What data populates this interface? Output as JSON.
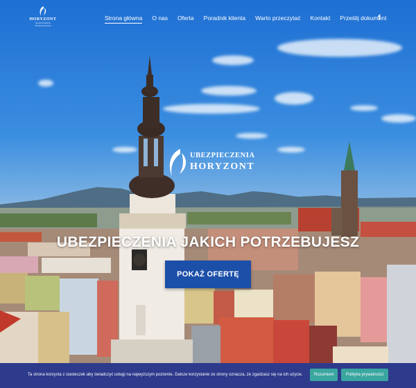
{
  "nav": {
    "logo_text": "HORYZONT",
    "logo_sub": "Grupa Doradcze Ubezpieczeniowe",
    "items": [
      {
        "label": "Strona główna",
        "active": true
      },
      {
        "label": "O nas"
      },
      {
        "label": "Oferta"
      },
      {
        "label": "Poradnik klienta"
      },
      {
        "label": "Warto przeczytać"
      },
      {
        "label": "Kontakt"
      },
      {
        "label": "Prześlij dokument"
      }
    ],
    "social_icon": "facebook-icon",
    "social_glyph": "f"
  },
  "hero": {
    "brand_line1": "UBEZPIECZENIA",
    "brand_line2": "HORYZONT",
    "headline": "UBEZPIECZENIA JAKICH POTRZEBUJESZ",
    "cta_label": "POKAŻ OFERTĘ"
  },
  "cookie": {
    "text": "Ta strona korzysta z ciasteczek aby świadczyć usługi na najwyższym poziomie. Dalsze korzystanie ze strony oznacza, że zgadzasz się na ich użycie.",
    "accept_label": "Rozumiem",
    "privacy_label": "Polityka prywatności"
  },
  "colors": {
    "cta_bg": "#1c4fa8",
    "cookie_bg": "#2e3a8c",
    "cookie_btn": "#3aa6a0"
  }
}
